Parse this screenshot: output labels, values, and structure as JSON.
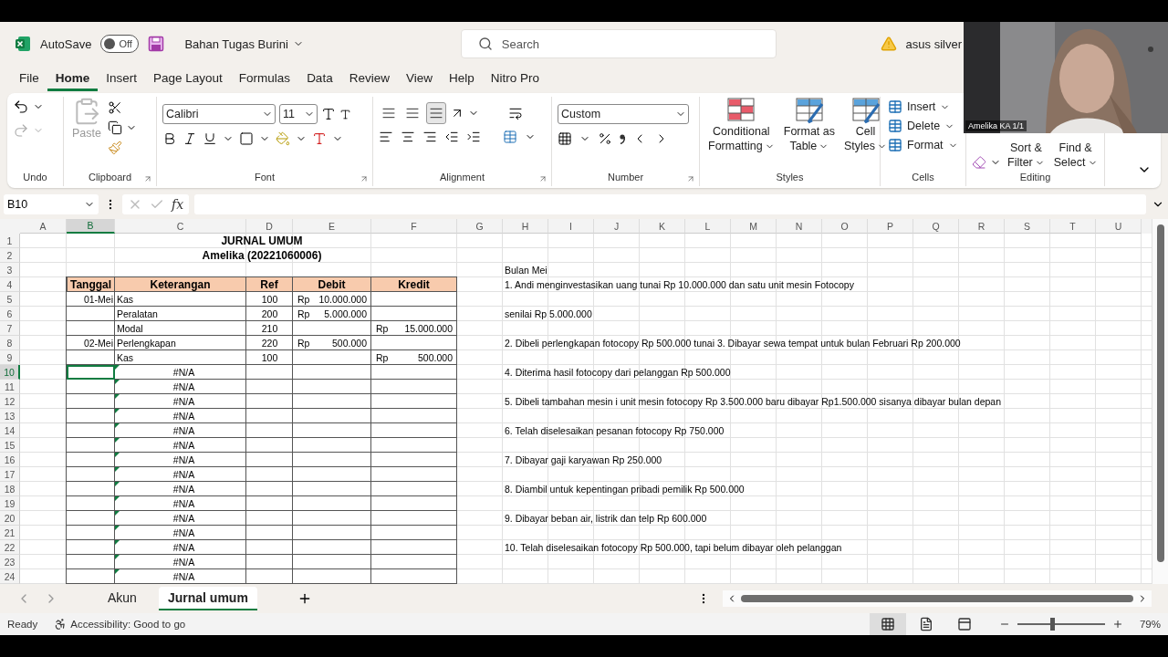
{
  "title_bar": {
    "autosave_label": "AutoSave",
    "autosave": {
      "on": false,
      "label": "Off"
    },
    "file_name": "Bahan Tugas Burini",
    "search_placeholder": "Search",
    "account": "asus silver"
  },
  "menu_tabs": [
    {
      "label": "File",
      "selected": false
    },
    {
      "label": "Home",
      "selected": true
    },
    {
      "label": "Insert",
      "selected": false
    },
    {
      "label": "Page Layout",
      "selected": false
    },
    {
      "label": "Formulas",
      "selected": false
    },
    {
      "label": "Data",
      "selected": false
    },
    {
      "label": "Review",
      "selected": false
    },
    {
      "label": "View",
      "selected": false
    },
    {
      "label": "Help",
      "selected": false
    },
    {
      "label": "Nitro Pro",
      "selected": false
    }
  ],
  "ribbon": {
    "undo": {
      "label": "Undo"
    },
    "clipboard": {
      "paste": "Paste",
      "label": "Clipboard"
    },
    "font": {
      "name": "Calibri",
      "size": "11",
      "label": "Font"
    },
    "alignment": {
      "vertical": [
        {
          "selected": false
        },
        {
          "selected": false
        },
        {
          "selected": true
        }
      ],
      "label": "Alignment"
    },
    "number": {
      "format": "Custom",
      "label": "Number"
    },
    "styles": {
      "items": [
        {
          "lines": [
            "Conditional",
            "Formatting"
          ]
        },
        {
          "lines": [
            "Format as",
            "Table"
          ]
        },
        {
          "lines": [
            "Cell",
            "Styles"
          ]
        }
      ],
      "label": "Styles"
    },
    "cells": {
      "items": [
        "Insert",
        "Delete",
        "Format"
      ],
      "label": "Cells"
    },
    "editing": {
      "items": [
        {
          "lines": [
            "Sort &",
            "Filter"
          ]
        },
        {
          "lines": [
            "Find &",
            "Select"
          ]
        }
      ],
      "label": "Editing"
    }
  },
  "formula_bar": {
    "name_box": "B10",
    "function_symbol": "fx"
  },
  "sheet": {
    "columns": [
      {
        "label": "A",
        "selected": false
      },
      {
        "label": "B",
        "selected": true
      },
      {
        "label": "C",
        "selected": false
      },
      {
        "label": "D",
        "selected": false
      },
      {
        "label": "E",
        "selected": false
      },
      {
        "label": "F",
        "selected": false
      },
      {
        "label": "G",
        "selected": false
      },
      {
        "label": "H",
        "selected": false
      },
      {
        "label": "I",
        "selected": false
      },
      {
        "label": "J",
        "selected": false
      },
      {
        "label": "K",
        "selected": false
      },
      {
        "label": "L",
        "selected": false
      },
      {
        "label": "M",
        "selected": false
      },
      {
        "label": "N",
        "selected": false
      },
      {
        "label": "O",
        "selected": false
      },
      {
        "label": "P",
        "selected": false
      },
      {
        "label": "Q",
        "selected": false
      },
      {
        "label": "R",
        "selected": false
      },
      {
        "label": "S",
        "selected": false
      },
      {
        "label": "T",
        "selected": false
      },
      {
        "label": "U",
        "selected": false
      }
    ],
    "rows": [
      {
        "number": "1",
        "kind": "title",
        "selected": false,
        "text": "JURNAL UMUM"
      },
      {
        "number": "2",
        "kind": "title",
        "selected": false,
        "text": "Amelika (20221060006)"
      },
      {
        "number": "3",
        "kind": "blank",
        "selected": false,
        "note": "Bulan Mei"
      },
      {
        "number": "4",
        "kind": "header",
        "selected": false,
        "cells": [
          "Tanggal",
          "Keterangan",
          "Ref",
          "Debit",
          "Kredit"
        ],
        "note": "1. Andi menginvestasikan uang tunai Rp 10.000.000 dan satu unit mesin Fotocopy"
      },
      {
        "number": "5",
        "kind": "entry",
        "selected": false,
        "date": "01-Mei",
        "account": "Kas",
        "ref": "100",
        "debit": {
          "currency": "Rp",
          "amount": "10.000.000"
        }
      },
      {
        "number": "6",
        "kind": "entry",
        "selected": false,
        "account": "Peralatan",
        "ref": "200",
        "debit": {
          "currency": "Rp",
          "amount": "5.000.000"
        },
        "note": "senilai Rp 5.000.000"
      },
      {
        "number": "7",
        "kind": "entry",
        "selected": false,
        "account": "Modal",
        "ref": "210",
        "credit": {
          "currency": "Rp",
          "amount": "15.000.000"
        }
      },
      {
        "number": "8",
        "kind": "entry",
        "selected": false,
        "date": "02-Mei",
        "account": "Perlengkapan",
        "ref": "220",
        "debit": {
          "currency": "Rp",
          "amount": "500.000"
        },
        "note": "2. Dibeli perlengkapan fotocopy Rp 500.000 tunai 3. Dibayar sewa tempat untuk bulan Februari Rp 200.000"
      },
      {
        "number": "9",
        "kind": "entry",
        "selected": false,
        "account": "Kas",
        "ref": "100",
        "credit": {
          "currency": "Rp",
          "amount": "500.000"
        }
      },
      {
        "number": "10",
        "kind": "error",
        "selected": true,
        "account": "#N/A",
        "note": "4. Diterima hasil fotocopy dari pelanggan Rp 500.000"
      },
      {
        "number": "11",
        "kind": "error",
        "selected": false,
        "account": "#N/A"
      },
      {
        "number": "12",
        "kind": "error",
        "selected": false,
        "account": "#N/A",
        "note": "5. Dibeli tambahan mesin i unit mesin fotocopy Rp 3.500.000 baru dibayar Rp1.500.000 sisanya dibayar bulan depan"
      },
      {
        "number": "13",
        "kind": "error",
        "selected": false,
        "account": "#N/A"
      },
      {
        "number": "14",
        "kind": "error",
        "selected": false,
        "account": "#N/A",
        "note": "6. Telah diselesaikan pesanan fotocopy Rp 750.000"
      },
      {
        "number": "15",
        "kind": "error",
        "selected": false,
        "account": "#N/A"
      },
      {
        "number": "16",
        "kind": "error",
        "selected": false,
        "account": "#N/A",
        "note": "7. Dibayar gaji karyawan Rp 250.000"
      },
      {
        "number": "17",
        "kind": "error",
        "selected": false,
        "account": "#N/A"
      },
      {
        "number": "18",
        "kind": "error",
        "selected": false,
        "account": "#N/A",
        "note": "8. Diambil untuk kepentingan pribadi pemilik Rp 500.000"
      },
      {
        "number": "19",
        "kind": "error",
        "selected": false,
        "account": "#N/A"
      },
      {
        "number": "20",
        "kind": "error",
        "selected": false,
        "account": "#N/A",
        "note": "9. Dibayar beban air, listrik dan telp Rp 600.000"
      },
      {
        "number": "21",
        "kind": "error",
        "selected": false,
        "account": "#N/A"
      },
      {
        "number": "22",
        "kind": "error",
        "selected": false,
        "account": "#N/A",
        "note": "10. Telah diselesaikan fotocopy Rp 500.000, tapi belum dibayar oleh pelanggan"
      },
      {
        "number": "23",
        "kind": "error",
        "selected": false,
        "account": "#N/A"
      },
      {
        "number": "24",
        "kind": "error",
        "selected": false,
        "account": "#N/A"
      }
    ]
  },
  "sheet_tabs": [
    {
      "label": "Akun",
      "selected": false
    },
    {
      "label": "Jurnal umum",
      "selected": true
    }
  ],
  "status_bar": {
    "ready": "Ready",
    "accessibility": "Accessibility: Good to go",
    "views": [
      {
        "selected": true
      },
      {
        "selected": false
      },
      {
        "selected": false
      }
    ],
    "zoom": {
      "level": 0.4,
      "reading": "79%"
    }
  },
  "video": {
    "caption": "Amelika KA 1/1"
  }
}
